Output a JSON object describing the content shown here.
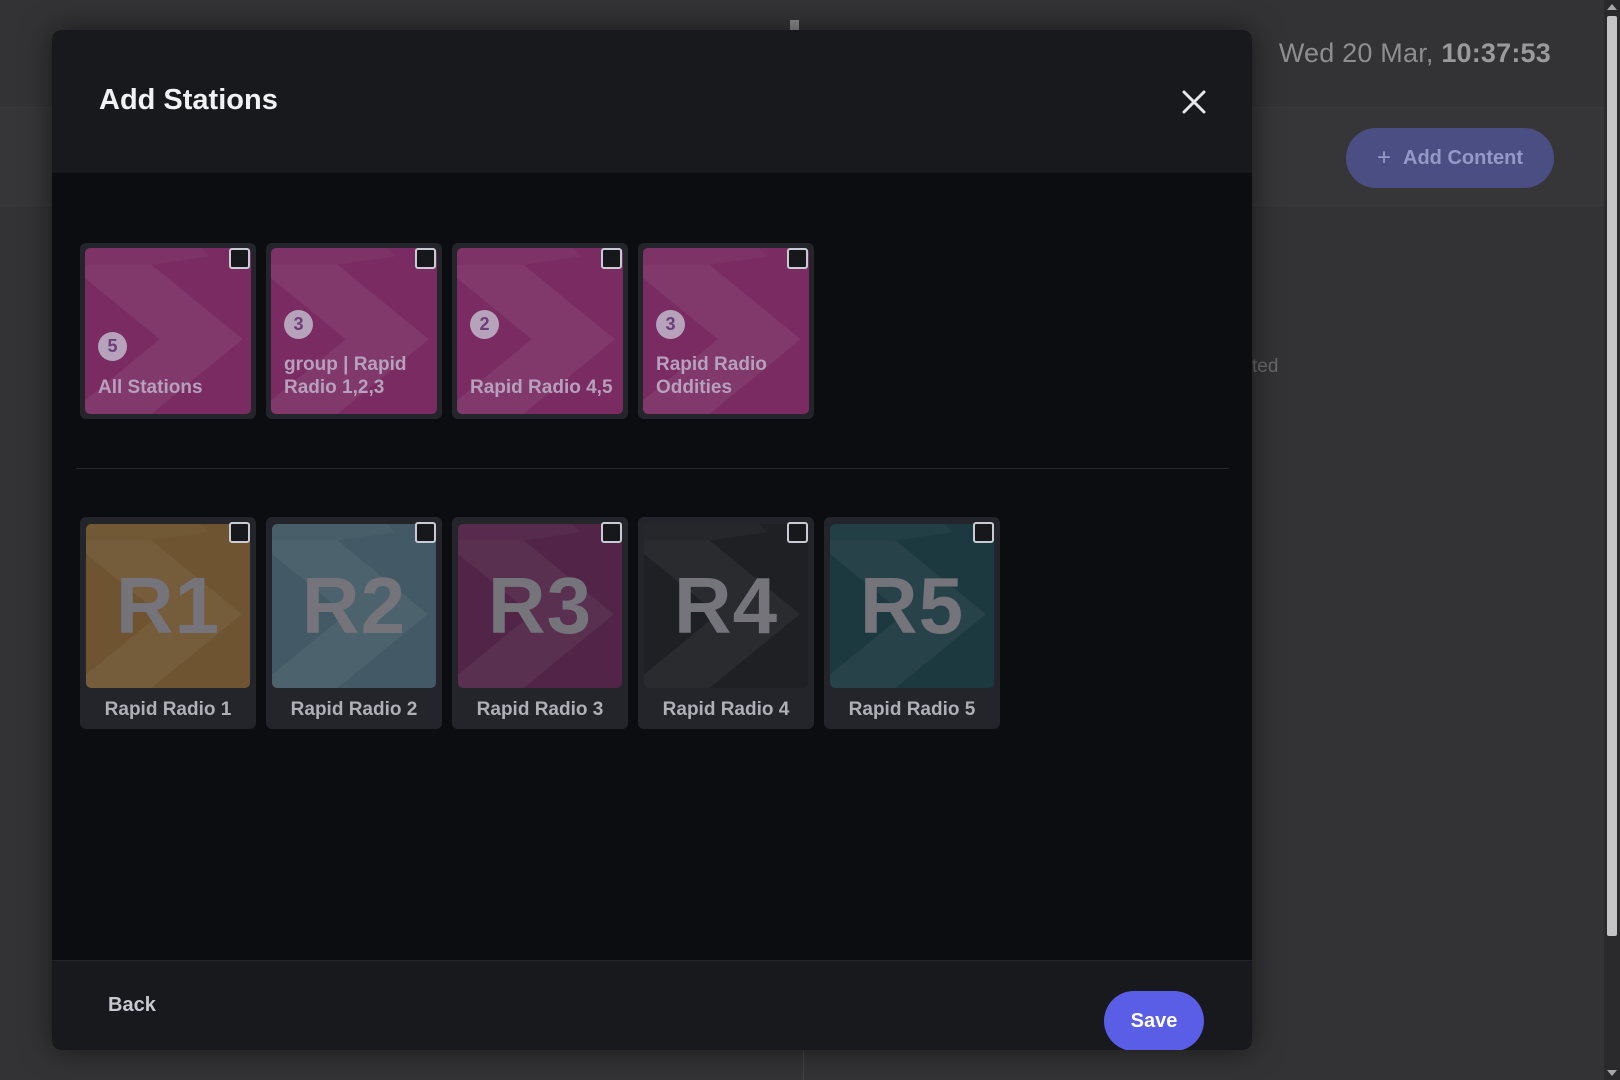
{
  "background": {
    "clock": {
      "date": "Wed 20 Mar,",
      "time": "10:37:53"
    },
    "add_content_label": "Add Content",
    "ghost_text": "ted"
  },
  "modal": {
    "title": "Add Stations",
    "groups": [
      {
        "label": "All Stations",
        "count": "5"
      },
      {
        "label": "group | Rapid Radio 1,2,3",
        "count": "3"
      },
      {
        "label": "Rapid Radio 4,5",
        "count": "2"
      },
      {
        "label": "Rapid Radio Oddities",
        "count": "3"
      }
    ],
    "stations": [
      {
        "code": "R1",
        "label": "Rapid Radio 1",
        "color": "#6e5430"
      },
      {
        "code": "R2",
        "label": "Rapid Radio 2",
        "color": "#435a66"
      },
      {
        "code": "R3",
        "label": "Rapid Radio 3",
        "color": "#522548"
      },
      {
        "code": "R4",
        "label": "Rapid Radio 4",
        "color": "#1f2024"
      },
      {
        "code": "R5",
        "label": "Rapid Radio 5",
        "color": "#1c3940"
      }
    ],
    "footer": {
      "back_label": "Back",
      "save_label": "Save"
    }
  },
  "colors": {
    "accent": "#5a5ee6",
    "group_tile": "#7a2c62"
  }
}
